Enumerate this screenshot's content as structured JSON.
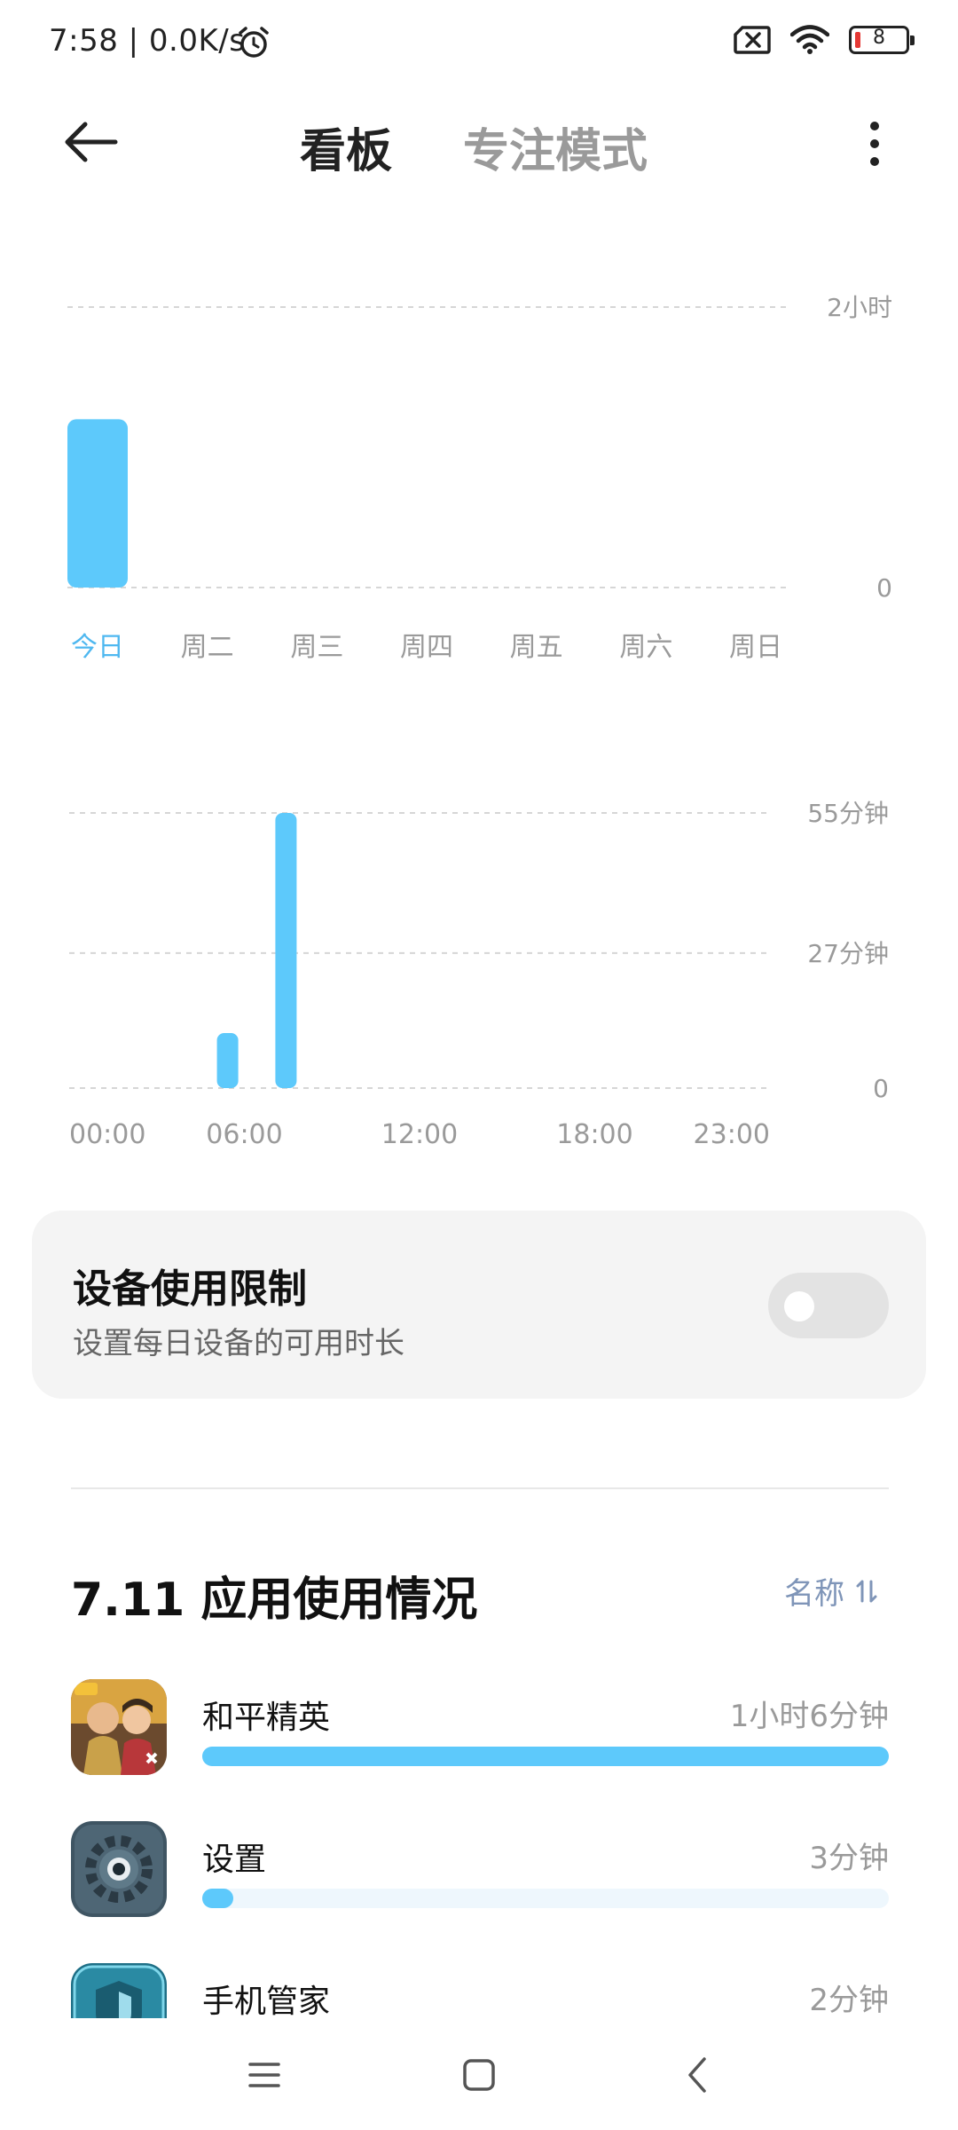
{
  "status_bar": {
    "time": "7:58 | 0.0K/s",
    "battery": "8",
    "icons": [
      "alarm-icon",
      "no-sim-icon",
      "wifi-icon",
      "battery-icon"
    ]
  },
  "header": {
    "back_icon": "arrow-left-icon",
    "tabs": [
      {
        "label": "看板",
        "active": true
      },
      {
        "label": "专注模式",
        "active": false
      }
    ],
    "more_icon": "more-vertical-icon"
  },
  "chart_data": [
    {
      "type": "bar",
      "categories": [
        "今日",
        "周二",
        "周三",
        "周四",
        "周五",
        "周六",
        "周日"
      ],
      "values": [
        1.2,
        0,
        0,
        0,
        0,
        0,
        0
      ],
      "y_tick_labels": [
        "2小时",
        "0"
      ],
      "ylim": [
        0,
        2
      ],
      "active_category": "今日",
      "color": "#5dc9fb"
    },
    {
      "type": "bar",
      "x": [
        5,
        7
      ],
      "values": [
        11,
        55
      ],
      "x_tick_labels": [
        "00:00",
        "06:00",
        "12:00",
        "18:00",
        "23:00"
      ],
      "x_tick_hours": [
        0,
        6,
        12,
        18,
        23
      ],
      "y_tick_labels": [
        "55分钟",
        "27分钟",
        "0"
      ],
      "y_tick_values": [
        55,
        27,
        0
      ],
      "ylim": [
        0,
        55
      ],
      "color": "#5dc9fb"
    }
  ],
  "limit_card": {
    "title": "设备使用限制",
    "subtitle": "设置每日设备的可用时长",
    "toggle_on": false
  },
  "usage": {
    "title": "7.11 应用使用情况",
    "sort_label": "名称",
    "sort_icon": "sort-icon",
    "apps": [
      {
        "name": "和平精英",
        "time": "1小时6分钟",
        "fraction": 1.0,
        "icon": "game-icon"
      },
      {
        "name": "设置",
        "time": "3分钟",
        "fraction": 0.045,
        "icon": "settings-gear-icon"
      },
      {
        "name": "手机管家",
        "time": "2分钟",
        "fraction": 0.03,
        "icon": "security-shield-icon"
      }
    ]
  },
  "nav": {
    "icons": [
      "menu-icon",
      "home-icon",
      "back-icon"
    ]
  },
  "colors": {
    "accent": "#5dc9fb",
    "active_label": "#4fb8f0",
    "sort_label": "#7f95b8"
  }
}
